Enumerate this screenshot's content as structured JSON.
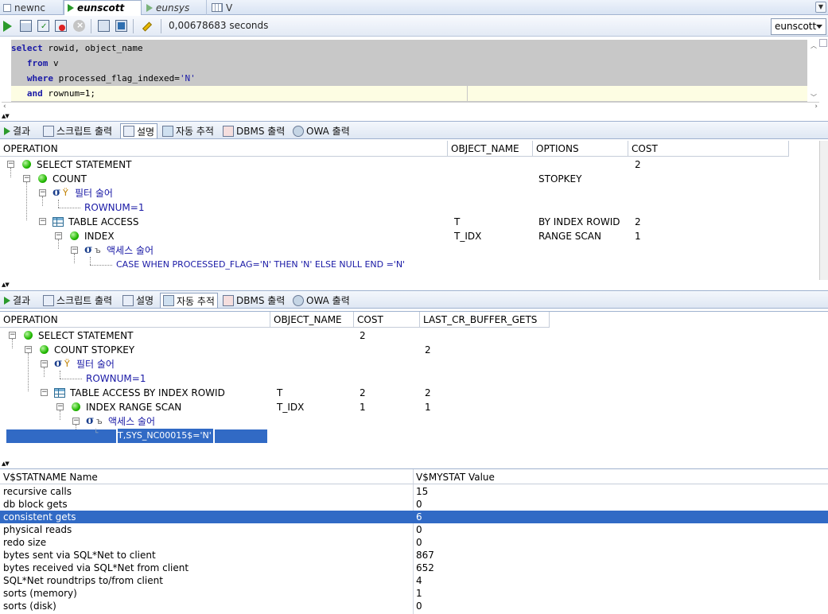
{
  "doc_tabs": [
    {
      "label": "newnc"
    },
    {
      "label": "eunscott"
    },
    {
      "label": "eunsys"
    },
    {
      "label": "V"
    }
  ],
  "toolbar": {
    "elapsed": "0,00678683 seconds",
    "connection": "eunscott"
  },
  "editor": {
    "lines": [
      {
        "kw1": "select",
        "rest": " rowid, object_name"
      },
      {
        "kw1": "   from",
        "rest": " v"
      },
      {
        "kw1": "   where",
        "rest": " processed_flag_indexed=",
        "str": "'N'"
      },
      {
        "kw1": "   and",
        "rest": " rownum=1;"
      }
    ]
  },
  "result_tabs_1": [
    "결과",
    "스크립트 출력",
    "설명",
    "자동 추적",
    "DBMS 출력",
    "OWA 출력"
  ],
  "result_tabs_2": [
    "결과",
    "스크립트 출력",
    "설명",
    "자동 추적",
    "DBMS 출력",
    "OWA 출력"
  ],
  "explain_plan": {
    "columns": [
      "OPERATION",
      "OBJECT_NAME",
      "OPTIONS",
      "COST"
    ],
    "rows": [
      {
        "op": "SELECT STATEMENT",
        "obj": "",
        "opt": "",
        "cost": "2"
      },
      {
        "op": "COUNT",
        "obj": "",
        "opt": "STOPKEY",
        "cost": ""
      },
      {
        "op": "필터 술어",
        "obj": "",
        "opt": "",
        "cost": ""
      },
      {
        "op": "ROWNUM=1",
        "obj": "",
        "opt": "",
        "cost": ""
      },
      {
        "op": "TABLE ACCESS",
        "obj": "T",
        "opt": "BY INDEX ROWID",
        "cost": "2"
      },
      {
        "op": "INDEX",
        "obj": "T_IDX",
        "opt": "RANGE SCAN",
        "cost": "1"
      },
      {
        "op": "액세스 술어",
        "obj": "",
        "opt": "",
        "cost": ""
      },
      {
        "op": "CASE  WHEN PROCESSED_FLAG='N' THEN 'N' ELSE NULL END ='N'",
        "obj": "",
        "opt": "",
        "cost": ""
      }
    ]
  },
  "autotrace": {
    "columns": [
      "OPERATION",
      "OBJECT_NAME",
      "COST",
      "LAST_CR_BUFFER_GETS"
    ],
    "rows": [
      {
        "op": "SELECT STATEMENT",
        "obj": "",
        "cost": "2",
        "gets": ""
      },
      {
        "op": "COUNT STOPKEY",
        "obj": "",
        "cost": "",
        "gets": "2"
      },
      {
        "op": "필터 술어",
        "obj": "",
        "cost": "",
        "gets": ""
      },
      {
        "op": "ROWNUM=1",
        "obj": "",
        "cost": "",
        "gets": ""
      },
      {
        "op": "TABLE ACCESS BY INDEX ROWID",
        "obj": "T",
        "cost": "2",
        "gets": "2"
      },
      {
        "op": "INDEX RANGE SCAN",
        "obj": "T_IDX",
        "cost": "1",
        "gets": "1"
      },
      {
        "op": "액세스 술어",
        "obj": "",
        "cost": "",
        "gets": ""
      },
      {
        "op": "T,SYS_NC00015$='N'",
        "obj": "",
        "cost": "",
        "gets": ""
      }
    ]
  },
  "stats": {
    "columns": [
      "V$STATNAME Name",
      "V$MYSTAT Value"
    ],
    "rows": [
      {
        "name": "recursive calls",
        "value": "15"
      },
      {
        "name": "db block gets",
        "value": "0"
      },
      {
        "name": "consistent gets",
        "value": "6"
      },
      {
        "name": "physical reads",
        "value": "0"
      },
      {
        "name": "redo size",
        "value": "0"
      },
      {
        "name": "bytes sent via SQL*Net to client",
        "value": "867"
      },
      {
        "name": "bytes received via SQL*Net from client",
        "value": "652"
      },
      {
        "name": "SQL*Net roundtrips to/from client",
        "value": "4"
      },
      {
        "name": "sorts (memory)",
        "value": "1"
      },
      {
        "name": "sorts (disk)",
        "value": "0"
      }
    ]
  },
  "colors": {
    "selection": "#316ac5",
    "keyword": "#1a1aa6",
    "tabbar": "#dfe7f3"
  }
}
